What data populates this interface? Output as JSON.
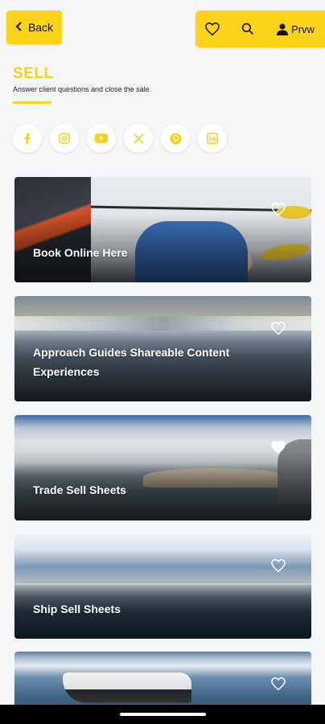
{
  "header": {
    "back_label": "Back",
    "profile_label": "Prvw",
    "accent_color": "#FCD21A"
  },
  "page": {
    "title": "SELL",
    "subtitle": "Answer client questions and close the sale."
  },
  "social": [
    {
      "icon": "facebook-icon"
    },
    {
      "icon": "instagram-icon"
    },
    {
      "icon": "youtube-icon"
    },
    {
      "icon": "x-icon"
    },
    {
      "icon": "pinterest-icon"
    },
    {
      "icon": "linkedin-icon"
    }
  ],
  "cards": [
    {
      "label": "Book Online Here",
      "favorited": false
    },
    {
      "label": "Approach Guides Shareable Content Experiences",
      "favorited": false
    },
    {
      "label": "Trade Sell Sheets",
      "favorited": true
    },
    {
      "label": "Ship Sell Sheets",
      "favorited": false
    },
    {
      "label": "",
      "favorited": false
    }
  ]
}
